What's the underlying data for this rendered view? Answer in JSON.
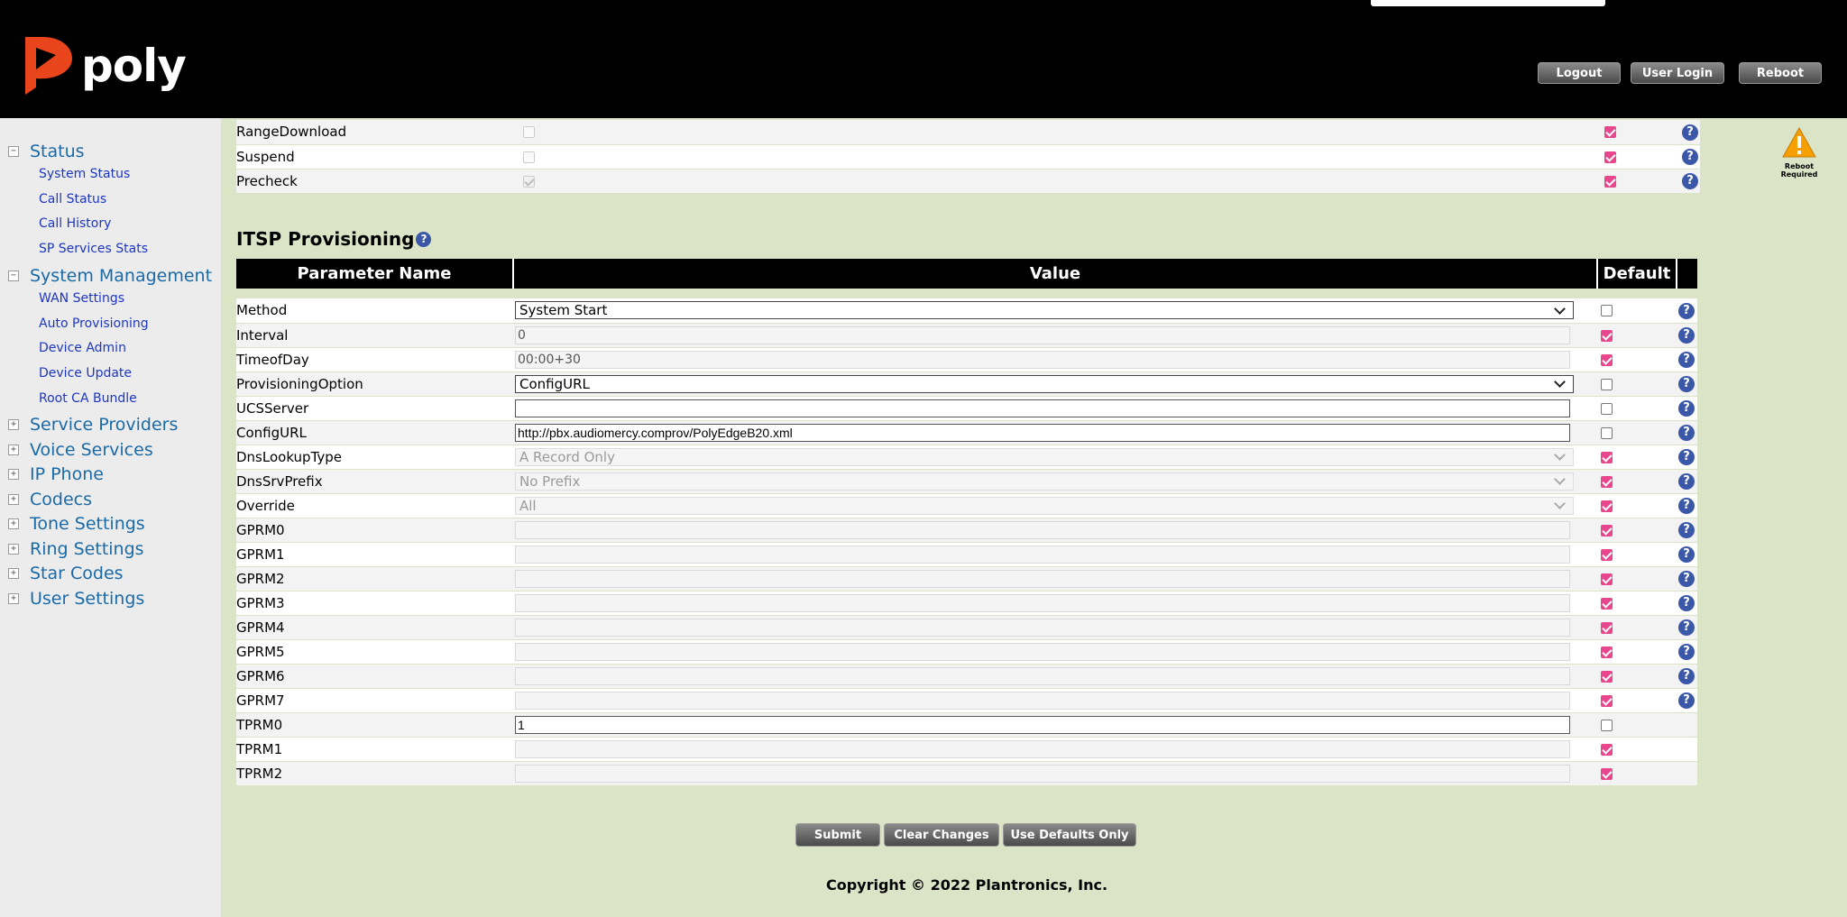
{
  "brand": {
    "name": "poly",
    "accent": "#e8451c"
  },
  "header_buttons": {
    "logout": "Logout",
    "user_login": "User Login",
    "reboot": "Reboot"
  },
  "sidebar": {
    "status": {
      "label": "Status",
      "items": [
        "System Status",
        "Call Status",
        "Call History",
        "SP Services Stats"
      ]
    },
    "system_management": {
      "label": "System Management",
      "items": [
        "WAN Settings",
        "Auto Provisioning",
        "Device Admin",
        "Device Update",
        "Root CA Bundle"
      ]
    },
    "sections": [
      "Service Providers",
      "Voice Services",
      "IP Phone",
      "Codecs",
      "Tone Settings",
      "Ring Settings",
      "Star Codes",
      "User Settings"
    ]
  },
  "top_rows": [
    {
      "name": "RangeDownload",
      "value_checkbox": "unchecked-disabled",
      "default": true
    },
    {
      "name": "Suspend",
      "value_checkbox": "unchecked-disabled",
      "default": true
    },
    {
      "name": "Precheck",
      "value_checkbox": "checked-disabled",
      "default": true
    }
  ],
  "itsp": {
    "title": "ITSP Provisioning",
    "columns": {
      "param": "Parameter Name",
      "value": "Value",
      "default": "Default"
    },
    "rows": [
      {
        "name": "Method",
        "type": "select",
        "value": "System Start",
        "default": false,
        "help": true
      },
      {
        "name": "Interval",
        "type": "input-disabled",
        "value": "0",
        "default": true,
        "help": true
      },
      {
        "name": "TimeofDay",
        "type": "input-disabled",
        "value": "00:00+30",
        "default": true,
        "help": true
      },
      {
        "name": "ProvisioningOption",
        "type": "select",
        "value": "ConfigURL",
        "default": false,
        "help": true
      },
      {
        "name": "UCSServer",
        "type": "input",
        "value": "",
        "default": false,
        "help": true
      },
      {
        "name": "ConfigURL",
        "type": "input",
        "value": "http://pbx.audiomercy.comprov/PolyEdgeB20.xml",
        "default": false,
        "help": true
      },
      {
        "name": "DnsLookupType",
        "type": "select-disabled",
        "value": "A Record Only",
        "default": true,
        "help": true
      },
      {
        "name": "DnsSrvPrefix",
        "type": "select-disabled",
        "value": "No Prefix",
        "default": true,
        "help": true
      },
      {
        "name": "Override",
        "type": "select-disabled",
        "value": "All",
        "default": true,
        "help": true
      },
      {
        "name": "GPRM0",
        "type": "input-disabled",
        "value": "",
        "default": true,
        "help": true
      },
      {
        "name": "GPRM1",
        "type": "input-disabled",
        "value": "",
        "default": true,
        "help": true
      },
      {
        "name": "GPRM2",
        "type": "input-disabled",
        "value": "",
        "default": true,
        "help": true
      },
      {
        "name": "GPRM3",
        "type": "input-disabled",
        "value": "",
        "default": true,
        "help": true
      },
      {
        "name": "GPRM4",
        "type": "input-disabled",
        "value": "",
        "default": true,
        "help": true
      },
      {
        "name": "GPRM5",
        "type": "input-disabled",
        "value": "",
        "default": true,
        "help": true
      },
      {
        "name": "GPRM6",
        "type": "input-disabled",
        "value": "",
        "default": true,
        "help": true
      },
      {
        "name": "GPRM7",
        "type": "input-disabled",
        "value": "",
        "default": true,
        "help": true
      },
      {
        "name": "TPRM0",
        "type": "input",
        "value": "1",
        "default": false,
        "help": false
      },
      {
        "name": "TPRM1",
        "type": "input-disabled",
        "value": "",
        "default": true,
        "help": false
      },
      {
        "name": "TPRM2",
        "type": "input-disabled",
        "value": "",
        "default": true,
        "help": false
      }
    ]
  },
  "footer_buttons": {
    "submit": "Submit",
    "clear": "Clear Changes",
    "defaults": "Use Defaults Only"
  },
  "copyright": "Copyright © 2022 Plantronics, Inc.",
  "reboot_notice": {
    "label": "Reboot Required",
    "icon": "warning-icon",
    "color": "#f5a000"
  },
  "help_icon": "?"
}
